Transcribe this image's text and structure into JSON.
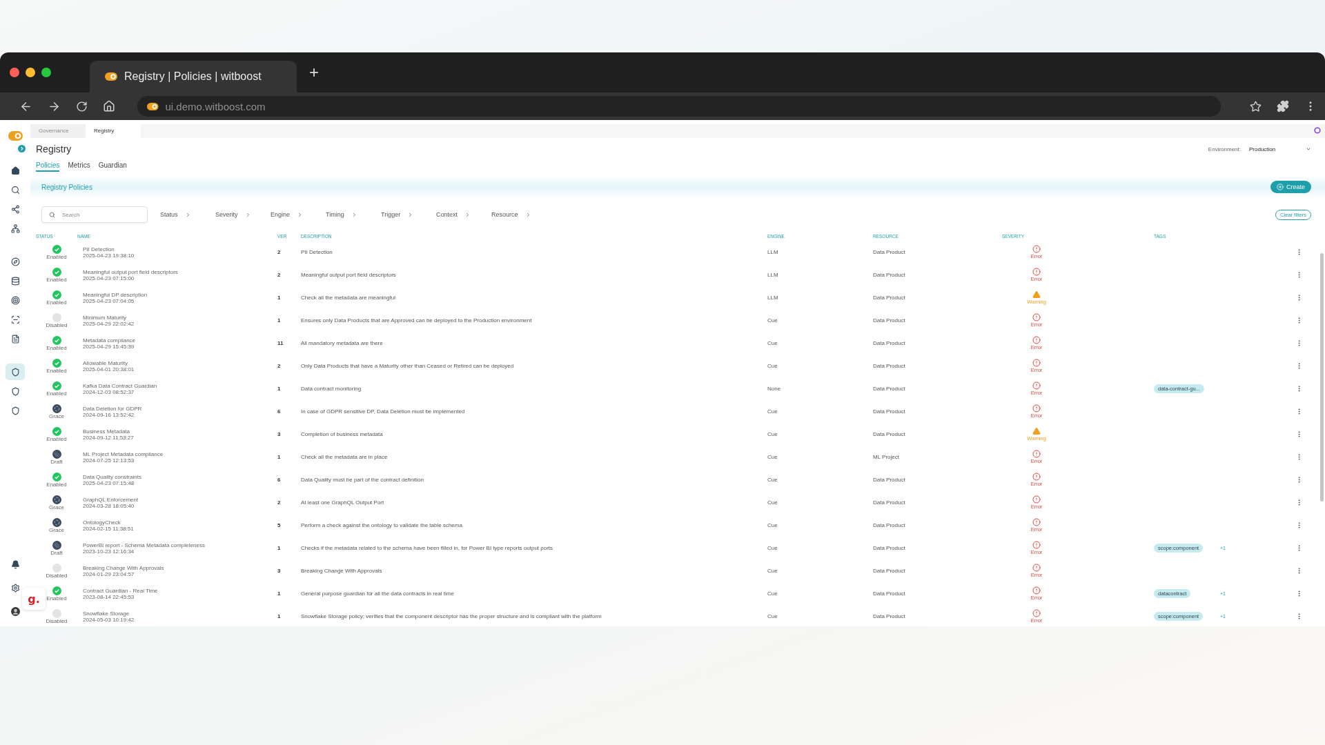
{
  "browser": {
    "tab_title": "Registry | Policies | witboost",
    "new_tab": "+",
    "url": "ui.demo.witboost.com"
  },
  "sidebar": {
    "items": [
      {
        "kind": "home",
        "selected": false
      },
      {
        "kind": "search",
        "selected": false
      },
      {
        "kind": "nodes",
        "selected": false
      },
      {
        "kind": "tree",
        "selected": false
      },
      {
        "kind": "compass",
        "selected": false
      },
      {
        "kind": "database",
        "selected": false
      },
      {
        "kind": "target",
        "selected": false
      },
      {
        "kind": "scan",
        "selected": false
      },
      {
        "kind": "list",
        "selected": false
      },
      {
        "kind": "shield",
        "selected": true
      },
      {
        "kind": "shield",
        "selected": false
      },
      {
        "kind": "shield",
        "selected": false
      }
    ],
    "bottom_items": [
      {
        "kind": "bell"
      },
      {
        "kind": "settings"
      },
      {
        "kind": "avatar"
      }
    ]
  },
  "breadcrumbs": [
    {
      "label": "Governance",
      "selected": false
    },
    {
      "label": "Registry",
      "selected": true
    }
  ],
  "page": {
    "title": "Registry",
    "environment_label": "Environment:",
    "environment_value": "Production"
  },
  "tabs": [
    {
      "label": "Policies",
      "selected": true
    },
    {
      "label": "Metrics",
      "selected": false
    },
    {
      "label": "Guardian",
      "selected": false
    }
  ],
  "section": {
    "title": "Registry Policies",
    "create_button": "Create"
  },
  "filters": {
    "search_placeholder": "Search",
    "items": [
      "Status",
      "Severity",
      "Engine",
      "Timing",
      "Trigger",
      "Context",
      "Resource"
    ],
    "clear_button": "Clear filters"
  },
  "table": {
    "columns": [
      "STATUS",
      "NAME",
      "VER",
      "DESCRIPTION",
      "ENGINE",
      "RESOURCE",
      "SEVERITY",
      "TAGS"
    ],
    "rows": [
      {
        "status": {
          "kind": "enabled",
          "label": "Enabled"
        },
        "name": "PII Detection",
        "date": "2025-04-23 19:38:10",
        "ver": "2",
        "description": "PII Detection",
        "engine": "LLM",
        "resource": "Data Product",
        "severity": {
          "kind": "error",
          "label": "Error"
        }
      },
      {
        "status": {
          "kind": "enabled",
          "label": "Enabled"
        },
        "name": "Meaningful output port field descriptors",
        "date": "2025-04-23 07:15:00",
        "ver": "2",
        "description": "Meaningful output port field descriptors",
        "engine": "LLM",
        "resource": "Data Product",
        "severity": {
          "kind": "error",
          "label": "Error"
        }
      },
      {
        "status": {
          "kind": "enabled",
          "label": "Enabled"
        },
        "name": "Meaningful DP description",
        "date": "2025-04-23 07:04:05",
        "ver": "1",
        "description": "Check all the metadata are meaningful",
        "engine": "LLM",
        "resource": "Data Product",
        "severity": {
          "kind": "warning",
          "label": "Warning"
        }
      },
      {
        "status": {
          "kind": "disabled",
          "label": "Disabled"
        },
        "name": "Minimum Maturity",
        "date": "2025-04-29 22:02:42",
        "ver": "1",
        "description": "Ensures only Data Products that are Approved can be deployed to the Production environment",
        "engine": "Cue",
        "resource": "Data Product",
        "severity": {
          "kind": "error",
          "label": "Error"
        }
      },
      {
        "status": {
          "kind": "enabled",
          "label": "Enabled"
        },
        "name": "Metadata compliance",
        "date": "2025-04-29 15:45:39",
        "ver": "11",
        "description": "All mandatory metadata are there",
        "engine": "Cue",
        "resource": "Data Product",
        "severity": {
          "kind": "error",
          "label": "Error"
        }
      },
      {
        "status": {
          "kind": "enabled",
          "label": "Enabled"
        },
        "name": "Allowable Maturity",
        "date": "2025-04-01 20:38:01",
        "ver": "2",
        "description": "Only Data Products that have a Maturity other than Ceased or Retired can be deployed",
        "engine": "Cue",
        "resource": "Data Product",
        "severity": {
          "kind": "error",
          "label": "Error"
        }
      },
      {
        "status": {
          "kind": "enabled",
          "label": "Enabled"
        },
        "name": "Kafka Data Contract Guardian",
        "date": "2024-12-03 08:52:37",
        "ver": "1",
        "description": "Data contract monitoring",
        "engine": "None",
        "resource": "Data Product",
        "severity": {
          "kind": "error",
          "label": "Error"
        },
        "tags": [
          "data-contract-gu..."
        ]
      },
      {
        "status": {
          "kind": "grace",
          "label": "Grace"
        },
        "name": "Data Deletion for GDPR",
        "date": "2024-09-16 13:52:42",
        "ver": "6",
        "description": "In case of GDPR sensitive DP, Data Deletion must be implemented",
        "engine": "Cue",
        "resource": "Data Product",
        "severity": {
          "kind": "error",
          "label": "Error"
        }
      },
      {
        "status": {
          "kind": "enabled",
          "label": "Enabled"
        },
        "name": "Business Metadata",
        "date": "2024-09-12 11:53:27",
        "ver": "3",
        "description": "Completion of business metadata",
        "engine": "Cue",
        "resource": "Data Product",
        "severity": {
          "kind": "warning",
          "label": "Warning"
        }
      },
      {
        "status": {
          "kind": "draft",
          "label": "Draft"
        },
        "name": "ML Project Metadata compliance",
        "date": "2024-07-25 12:13:53",
        "ver": "1",
        "description": "Check all the metadata are in place",
        "engine": "Cue",
        "resource": "ML Project",
        "severity": {
          "kind": "error",
          "label": "Error"
        }
      },
      {
        "status": {
          "kind": "enabled",
          "label": "Enabled"
        },
        "name": "Data Quality constraints",
        "date": "2025-04-23 07:15:48",
        "ver": "6",
        "description": "Data Quality must be part of the contract definition",
        "engine": "Cue",
        "resource": "Data Product",
        "severity": {
          "kind": "error",
          "label": "Error"
        }
      },
      {
        "status": {
          "kind": "grace",
          "label": "Grace"
        },
        "name": "GraphQL Enforcement",
        "date": "2024-03-28 18:05:40",
        "ver": "2",
        "description": "At least one GraphQL Output Port",
        "engine": "Cue",
        "resource": "Data Product",
        "severity": {
          "kind": "error",
          "label": "Error"
        }
      },
      {
        "status": {
          "kind": "grace",
          "label": "Grace"
        },
        "name": "OntologyCheck",
        "date": "2024-02-15 11:38:51",
        "ver": "5",
        "description": "Perform a check against the ontology to validate the table schema",
        "engine": "Cue",
        "resource": "Data Product",
        "severity": {
          "kind": "error",
          "label": "Error"
        }
      },
      {
        "status": {
          "kind": "draft",
          "label": "Draft"
        },
        "name": "PowerBI report - Schema Metadata completeness",
        "date": "2023-10-23 12:16:34",
        "ver": "1",
        "description": "Checks if the metadata related to the schema have been filled in, for Power BI type reports output ports",
        "engine": "Cue",
        "resource": "Data Product",
        "severity": {
          "kind": "error",
          "label": "Error"
        },
        "tags": [
          "scope:component"
        ],
        "more_tags": "+1"
      },
      {
        "status": {
          "kind": "disabled",
          "label": "Disabled"
        },
        "name": "Breaking Change With Approvals",
        "date": "2024-01-29 23:04:57",
        "ver": "3",
        "description": "Breaking Change With Approvals",
        "engine": "Cue",
        "resource": "Data Product",
        "severity": {
          "kind": "error",
          "label": "Error"
        }
      },
      {
        "status": {
          "kind": "enabled",
          "label": "Enabled"
        },
        "name": "Contract Guardian - Real Time",
        "date": "2023-08-14 22:45:53",
        "ver": "1",
        "description": "General purpose guardian for all the data contracts in real time",
        "engine": "Cue",
        "resource": "Data Product",
        "severity": {
          "kind": "error",
          "label": "Error"
        },
        "tags": [
          "datacontract"
        ],
        "more_tags": "+1"
      },
      {
        "status": {
          "kind": "disabled",
          "label": "Disabled"
        },
        "name": "Snowflake Storage",
        "date": "2024-05-03 10:19:42",
        "ver": "1",
        "description": "Snowflake Storage policy; verifies that the component descriptor has the proper structure and is compliant with the platform",
        "engine": "Cue",
        "resource": "Data Product",
        "severity": {
          "kind": "error",
          "label": "Error"
        },
        "tags": [
          "scope:component"
        ],
        "more_tags": "+1"
      }
    ]
  },
  "floating_widget": "g."
}
